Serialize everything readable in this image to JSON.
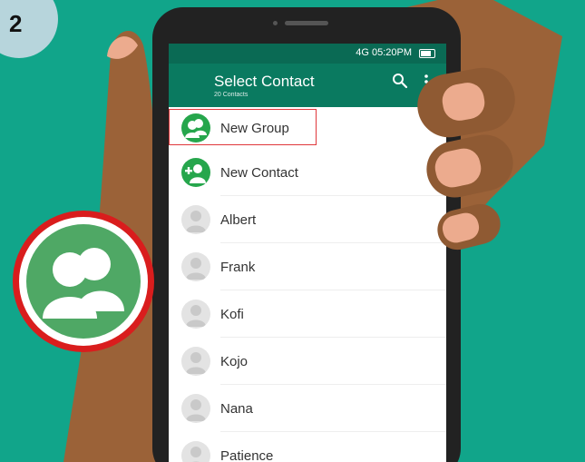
{
  "step_badge": {
    "number": "2"
  },
  "status_bar": {
    "text": "4G  05:20PM"
  },
  "app_bar": {
    "title": "Select Contact",
    "subtitle": "20 Contacts"
  },
  "icons": {
    "search": "search-icon",
    "more": "more-vert-icon",
    "battery": "battery-icon",
    "group": "group-icon",
    "add_contact": "person-add-icon",
    "person": "person-icon"
  },
  "contacts": {
    "new_group": "New Group",
    "new_contact": "New Contact",
    "items": [
      "Albert",
      "Frank",
      "Kofi",
      "Kojo",
      "Nana",
      "Patience"
    ]
  },
  "colors": {
    "background": "#11a58a",
    "app_bar": "#0a7a60",
    "status_bar": "#0a6a54",
    "action_green": "#26a64c",
    "highlight_red": "#e0373b"
  }
}
